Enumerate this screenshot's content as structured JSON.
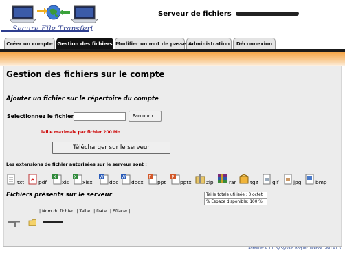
{
  "header": {
    "logo_text": "Secure File Transfert",
    "title": "Serveur de fichiers"
  },
  "tabs": [
    {
      "label": "Créer un compte",
      "active": false
    },
    {
      "label": "Gestion des fichiers",
      "active": true
    },
    {
      "label": "Modifier un mot de passe",
      "active": false
    },
    {
      "label": "Administration",
      "active": false
    },
    {
      "label": "Déconnexion",
      "active": false
    }
  ],
  "main": {
    "title": "Gestion des fichiers sur le compte",
    "upload": {
      "section_title": "Ajouter un fichier sur le répertoire du compte",
      "file_label": "Selectionnez le fichier",
      "file_value": "",
      "browse_label": "Parcourir...",
      "max_size": "Taille maximale par fichier 200 Mo",
      "submit_label": "Télécharger sur le serveur"
    },
    "extensions_title": "Les extensions de fichier autorisées sur le serveur sont :",
    "extensions": [
      "txt",
      "pdf",
      "xls",
      "xlsx",
      "doc",
      "docx",
      "ppt",
      "pptx",
      "zip",
      "rar",
      "tgz",
      "gif",
      "jpg",
      "bmp"
    ],
    "files": {
      "section_title": "Fichiers présents sur le serveur",
      "total_size": "Taille totale utilisée : 0 octet",
      "free_space": "% Espace disponible: 100 %",
      "columns": [
        "| Nom du fichier",
        "| Taille",
        "| Date",
        "| Effacer |"
      ]
    }
  },
  "footer": {
    "text": "adminsft V 1.0 by Sylvain Boquet. licence GNU V1.3"
  },
  "colors": {
    "accent_orange": "#f4a64a",
    "tab_active": "#111111",
    "error_red": "#cc0000",
    "link_blue": "#1b3a8a"
  }
}
